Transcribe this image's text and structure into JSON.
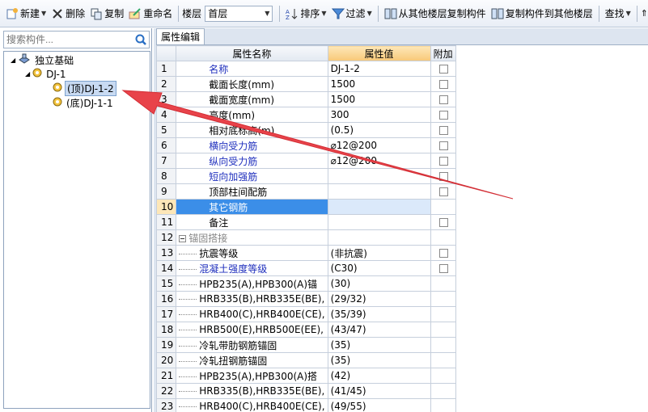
{
  "toolbar": {
    "new_label": "新建",
    "delete_label": "删除",
    "copy_label": "复制",
    "rename_label": "重命名",
    "floor_label": "楼层",
    "floor_value": "首层",
    "sort_label": "排序",
    "filter_label": "过滤",
    "copy_from_floor_label": "从其他楼层复制构件",
    "copy_to_floor_label": "复制构件到其他楼层",
    "find_label": "查找"
  },
  "search": {
    "placeholder": "搜索构件..."
  },
  "tree": {
    "root": "独立基础",
    "child": "DJ-1",
    "leaf_top": "(顶)DJ-1-2",
    "leaf_bottom": "(底)DJ-1-1"
  },
  "tab": {
    "label": "属性编辑"
  },
  "grid": {
    "headers": {
      "name": "属性名称",
      "value": "属性值",
      "extra": "附加"
    },
    "rows": [
      {
        "n": "1",
        "name": "名称",
        "value": "DJ-1-2"
      },
      {
        "n": "2",
        "name": "截面长度(mm)",
        "value": "1500"
      },
      {
        "n": "3",
        "name": "截面宽度(mm)",
        "value": "1500"
      },
      {
        "n": "4",
        "name": "高度(mm)",
        "value": "300"
      },
      {
        "n": "5",
        "name": "相对底标高(m)",
        "value": "(0.5)"
      },
      {
        "n": "6",
        "name": "横向受力筋",
        "value": "⌀12@200"
      },
      {
        "n": "7",
        "name": "纵向受力筋",
        "value": "⌀12@200"
      },
      {
        "n": "8",
        "name": "短向加强筋",
        "value": ""
      },
      {
        "n": "9",
        "name": "顶部柱间配筋",
        "value": ""
      },
      {
        "n": "10",
        "name": "其它钢筋",
        "value": ""
      },
      {
        "n": "11",
        "name": "备注",
        "value": ""
      },
      {
        "n": "12",
        "name": "锚固搭接",
        "value": ""
      },
      {
        "n": "13",
        "name": "抗震等级",
        "value": "(非抗震)"
      },
      {
        "n": "14",
        "name": "混凝土强度等级",
        "value": "(C30)"
      },
      {
        "n": "15",
        "name": "HPB235(A),HPB300(A)锚",
        "value": "(30)"
      },
      {
        "n": "16",
        "name": "HRB335(B),HRB335E(BE),",
        "value": "(29/32)"
      },
      {
        "n": "17",
        "name": "HRB400(C),HRB400E(CE),",
        "value": "(35/39)"
      },
      {
        "n": "18",
        "name": "HRB500(E),HRB500E(EE),",
        "value": "(43/47)"
      },
      {
        "n": "19",
        "name": "冷轧带肋钢筋锚固",
        "value": "(35)"
      },
      {
        "n": "20",
        "name": "冷轧扭钢筋锚固",
        "value": "(35)"
      },
      {
        "n": "21",
        "name": "HPB235(A),HPB300(A)搭",
        "value": "(42)"
      },
      {
        "n": "22",
        "name": "HRB335(B),HRB335E(BE),",
        "value": "(41/45)"
      },
      {
        "n": "23",
        "name": "HRB400(C),HRB400E(CE),",
        "value": "(49/55)"
      }
    ]
  },
  "colors": {
    "blue_text": "#1f2fbd",
    "arrow": "#e8434a",
    "selection": "#3b8ee8"
  }
}
